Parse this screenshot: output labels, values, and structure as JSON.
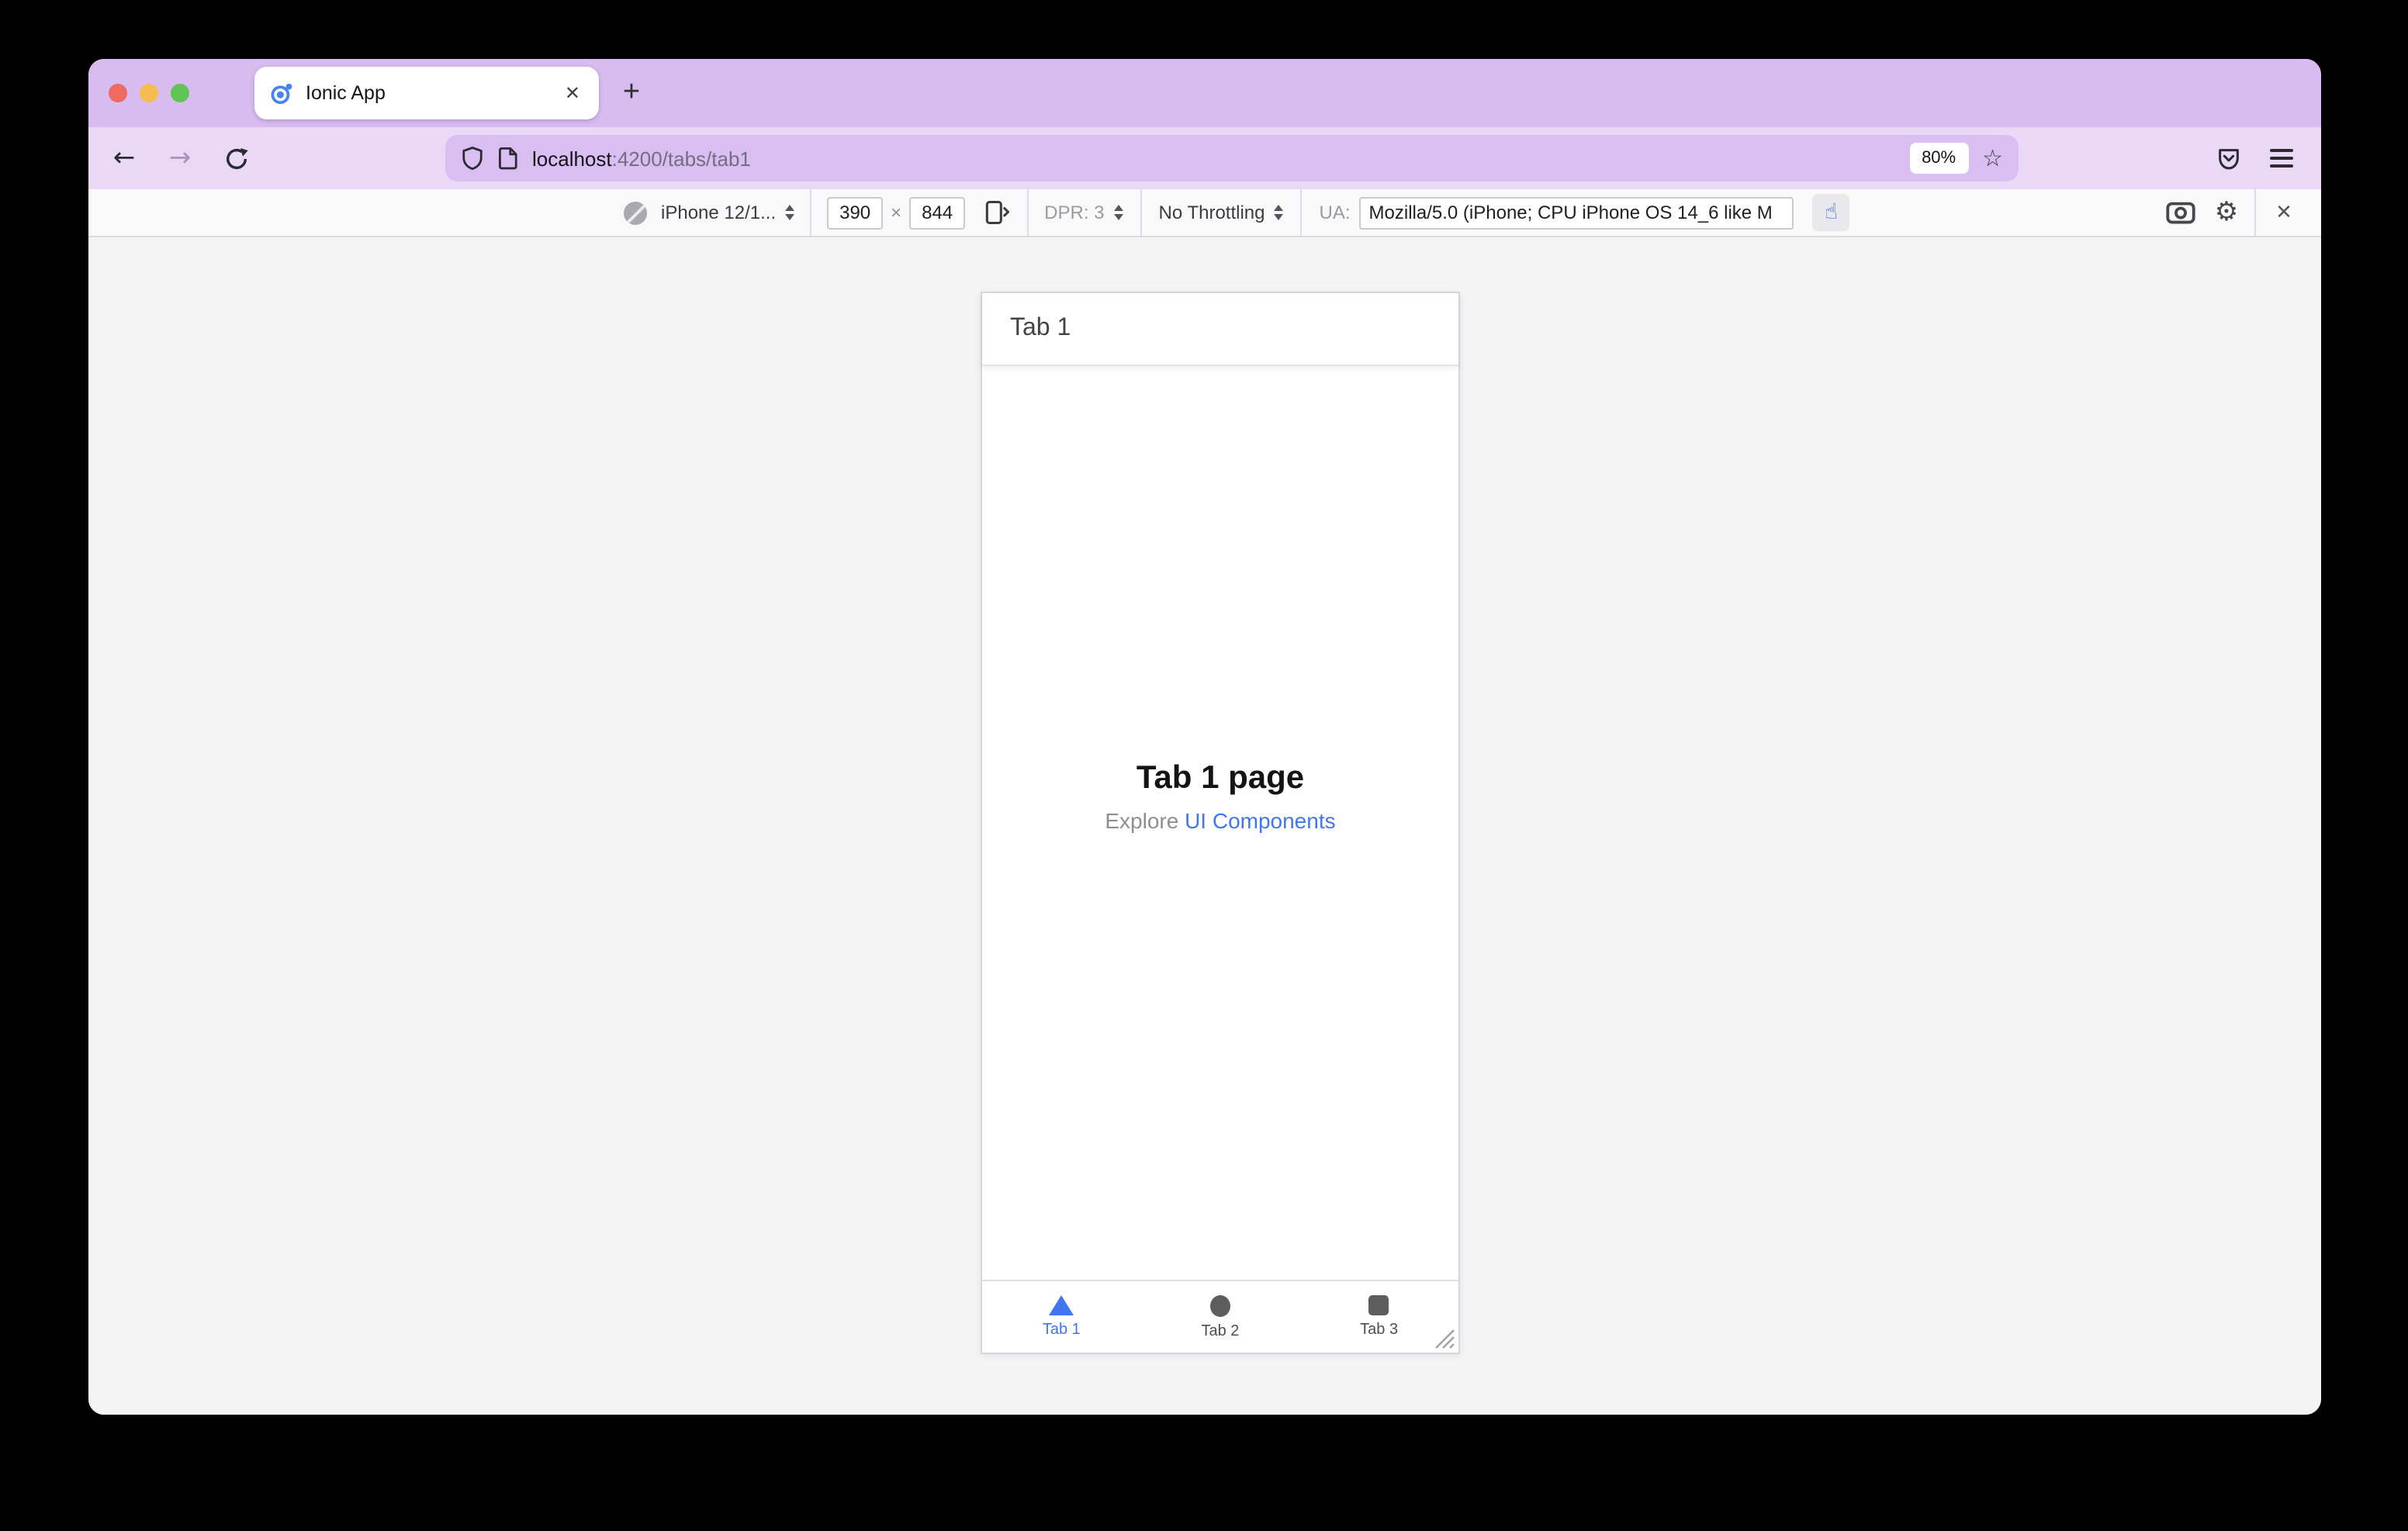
{
  "browser": {
    "tab": {
      "title": "Ionic App",
      "close_icon": "✕",
      "new_tab_icon": "+"
    },
    "toolbar": {
      "back_icon": "←",
      "forward_icon": "→",
      "url": {
        "host": "localhost",
        "path": ":4200/tabs/tab1",
        "zoom_badge": "80%",
        "star_icon": "☆"
      }
    }
  },
  "responsive_toolbar": {
    "device_selector": "iPhone 12/1...",
    "viewport_width": "390",
    "dimension_separator": "×",
    "viewport_height": "844",
    "dpr_label": "DPR: 3",
    "throttling_label": "No Throttling",
    "ua_label": "UA:",
    "ua_value": "Mozilla/5.0 (iPhone; CPU iPhone OS 14_6 like M",
    "touch_icon_glyph": "☝",
    "gear_icon_glyph": "⚙",
    "close_icon": "✕"
  },
  "app": {
    "header_title": "Tab 1",
    "content": {
      "title": "Tab 1 page",
      "subtitle_prefix": "Explore ",
      "subtitle_link": "UI Components"
    },
    "tab_bar": [
      {
        "label": "Tab 1",
        "icon": "triangle",
        "active": true
      },
      {
        "label": "Tab 2",
        "icon": "ellipse",
        "active": false
      },
      {
        "label": "Tab 3",
        "icon": "square",
        "active": false
      }
    ]
  },
  "colors": {
    "accent_blue": "#4176f2",
    "titlebar_purple": "#d8bcf0",
    "toolbar_purple": "#e9d8f6",
    "urlbar_purple": "#d9bef1"
  }
}
